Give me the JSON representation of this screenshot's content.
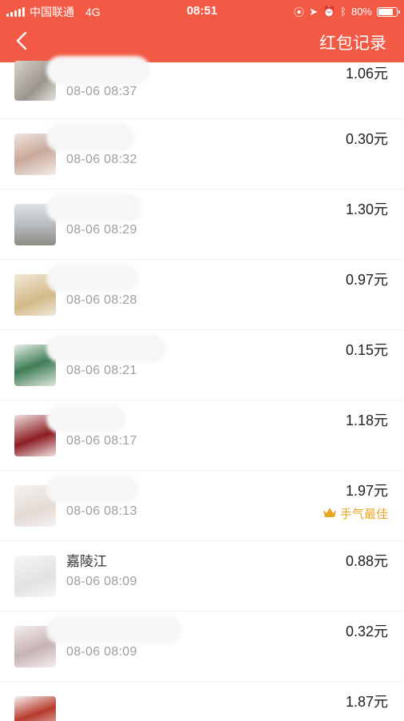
{
  "status_bar": {
    "carrier": "中国联通",
    "network": "4G",
    "time": "08:51",
    "battery": "80%",
    "battery_level": 0.8
  },
  "nav": {
    "title": "红包记录"
  },
  "colors": {
    "header_bg": "#f25a45",
    "best_luck": "#e9a524"
  },
  "records": [
    {
      "name": "",
      "time": "08-06 08:37",
      "amount": "1.06元",
      "best": ""
    },
    {
      "name": "",
      "time": "08-06 08:32",
      "amount": "0.30元",
      "best": ""
    },
    {
      "name": "",
      "time": "08-06 08:29",
      "amount": "1.30元",
      "best": ""
    },
    {
      "name": "",
      "time": "08-06 08:28",
      "amount": "0.97元",
      "best": ""
    },
    {
      "name": "",
      "time": "08-06 08:21",
      "amount": "0.15元",
      "best": ""
    },
    {
      "name": "",
      "time": "08-06 08:17",
      "amount": "1.18元",
      "best": ""
    },
    {
      "name": "",
      "time": "08-06 08:13",
      "amount": "1.97元",
      "best": "手气最佳"
    },
    {
      "name": "嘉陵江",
      "time": "08-06 08:09",
      "amount": "0.88元",
      "best": ""
    },
    {
      "name": "",
      "time": "08-06 08:09",
      "amount": "0.32元",
      "best": ""
    },
    {
      "name": "",
      "time": "",
      "amount": "1.87元",
      "best": ""
    }
  ]
}
